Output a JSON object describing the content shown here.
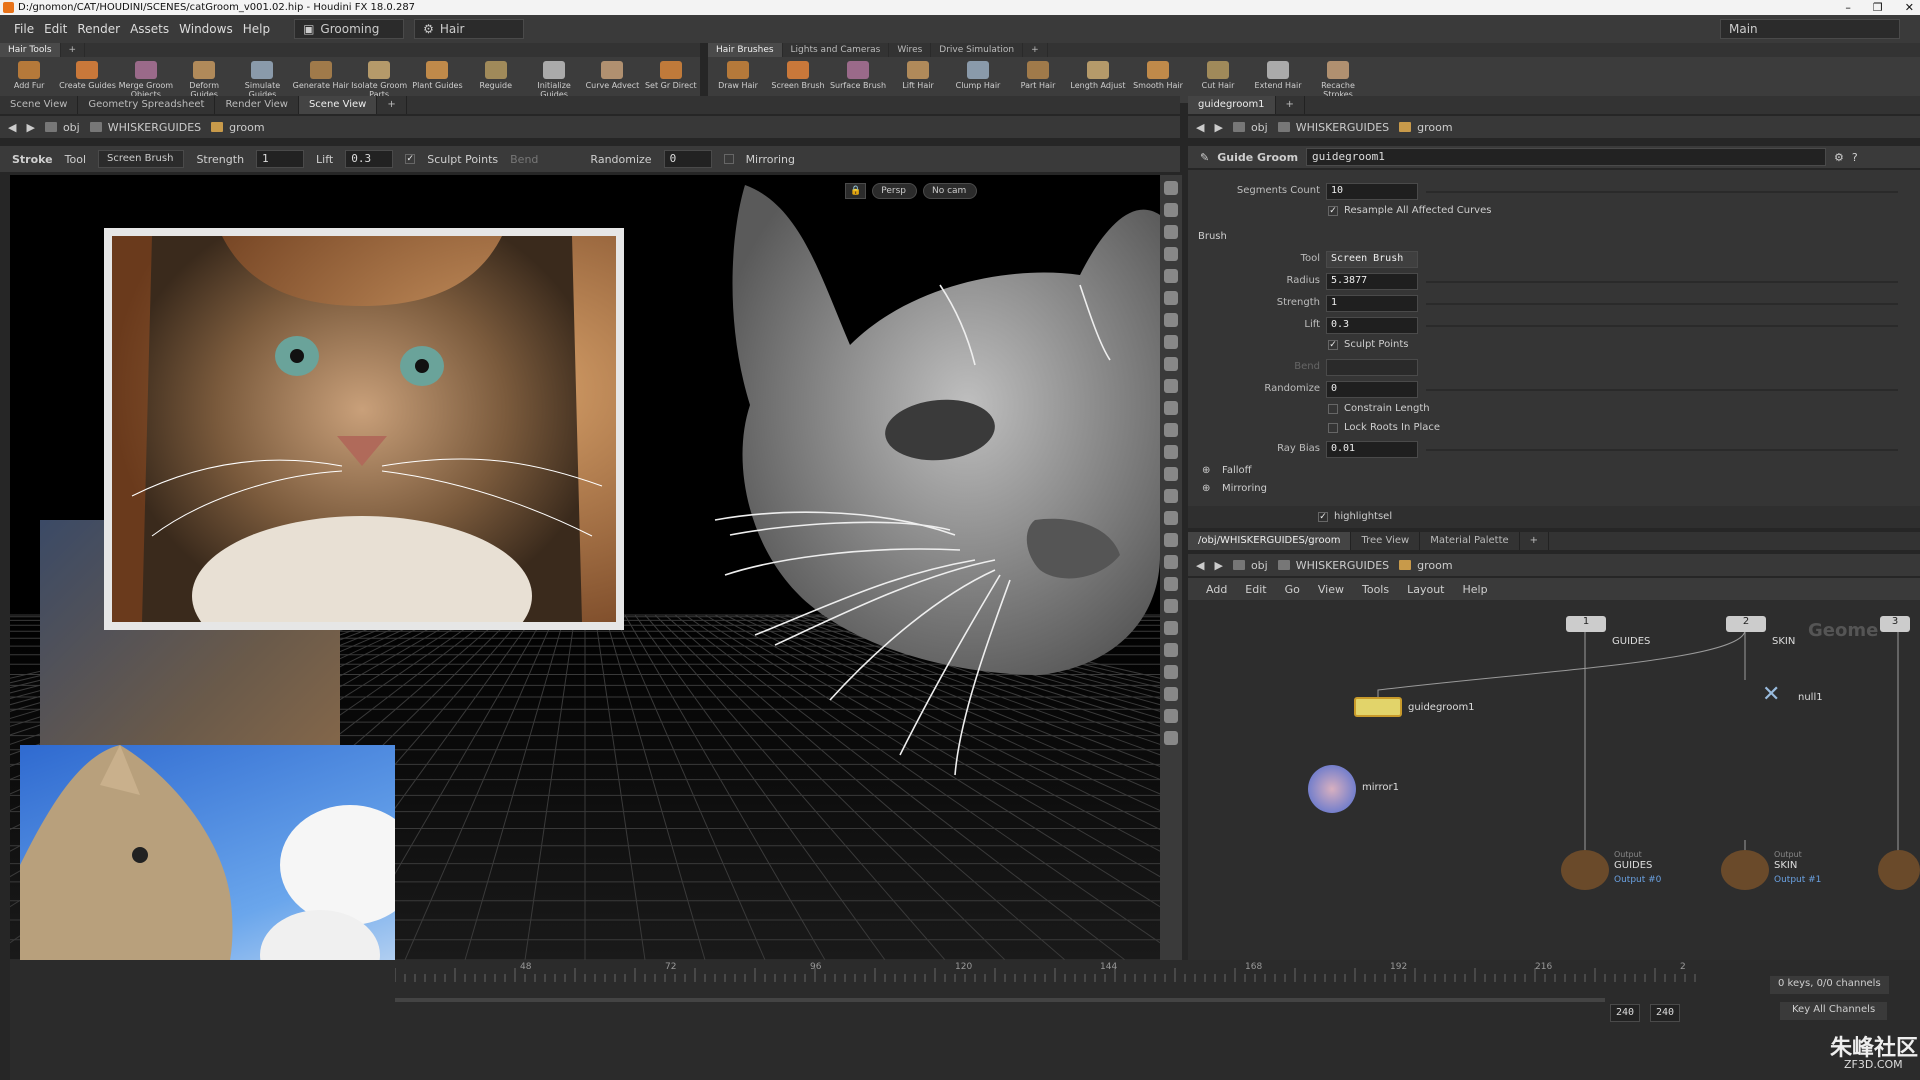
{
  "window": {
    "title": "D:/gnomon/CAT/HOUDINI/SCENES/catGroom_v001.02.hip - Houdini FX 18.0.287"
  },
  "menu": {
    "items": [
      "File",
      "Edit",
      "Render",
      "Assets",
      "Windows",
      "Help"
    ],
    "desktop": "Grooming",
    "context": "Hair",
    "layout": "Main"
  },
  "shelf_left": {
    "tabs": [
      "Hair Tools"
    ],
    "tools": [
      "Add Fur",
      "Create Guides",
      "Merge Groom Objects",
      "Deform Guides",
      "Simulate Guides",
      "Generate Hair",
      "Isolate Groom Parts",
      "Plant Guides",
      "Reguide",
      "Initialize Guides",
      "Curve Advect",
      "Set Gr Direct"
    ]
  },
  "shelf_right": {
    "tabs": [
      "Hair Brushes",
      "Lights and Cameras",
      "Wires",
      "Drive Simulation"
    ],
    "tools": [
      "Draw Hair",
      "Screen Brush",
      "Surface Brush",
      "Lift Hair",
      "Clump Hair",
      "Part Hair",
      "Length Adjust",
      "Smooth Hair",
      "Cut Hair",
      "Extend Hair",
      "Recache Strokes"
    ]
  },
  "left_tabs": [
    "Scene View",
    "Geometry Spreadsheet",
    "Render View",
    "Scene View"
  ],
  "left_path": {
    "obj": "obj",
    "guides": "WHISKERGUIDES",
    "groom": "groom"
  },
  "opbar": {
    "stroke": "Stroke",
    "tool": "Tool",
    "tool_value": "Screen Brush",
    "strength_label": "Strength",
    "strength": "1",
    "lift_label": "Lift",
    "lift": "0.3",
    "sculpt": "Sculpt Points",
    "bend": "Bend",
    "randomize_label": "Randomize",
    "randomize": "0",
    "mirroring": "Mirroring"
  },
  "viewport": {
    "persp": "Persp",
    "cam": "No cam"
  },
  "right_tabs": [
    "guidegroom1"
  ],
  "right_path": {
    "obj": "obj",
    "guides": "WHISKERGUIDES",
    "groom": "groom"
  },
  "parm_header": {
    "type": "Guide Groom",
    "name": "guidegroom1"
  },
  "parms": {
    "segments_count_label": "Segments Count",
    "segments_count": "10",
    "resample": "Resample All Affected Curves",
    "brush_section": "Brush",
    "tool_label": "Tool",
    "tool_value": "Screen Brush",
    "radius_label": "Radius",
    "radius": "5.3877",
    "strength_label": "Strength",
    "strength": "1",
    "lift_label": "Lift",
    "lift": "0.3",
    "sculpt": "Sculpt Points",
    "bend_label": "Bend",
    "randomize_label": "Randomize",
    "randomize": "0",
    "constrain": "Constrain Length",
    "lock": "Lock Roots In Place",
    "raybias_label": "Ray Bias",
    "raybias": "0.01",
    "falloff": "Falloff",
    "mirroring": "Mirroring",
    "highlight": "highlightsel"
  },
  "net_tabs": [
    "/obj/WHISKERGUIDES/groom",
    "Tree View",
    "Material Palette"
  ],
  "net_path": {
    "obj": "obj",
    "guides": "WHISKERGUIDES",
    "groom": "groom"
  },
  "net_menu": [
    "Add",
    "Edit",
    "Go",
    "View",
    "Tools",
    "Layout",
    "Help"
  ],
  "nodes": {
    "guides_num": "1",
    "guides": "GUIDES",
    "skin_num": "2",
    "skin": "SKIN",
    "three": "3",
    "geo_watermark": "Geome",
    "guidegroom": "guidegroom1",
    "null": "null1",
    "mirror": "mirror1",
    "out_guides_type": "Output",
    "out_guides": "GUIDES",
    "out_guides_sub": "Output #0",
    "out_skin_type": "Output",
    "out_skin": "SKIN",
    "out_skin_sub": "Output #1"
  },
  "timeline": {
    "ticks": [
      "48",
      "72",
      "96",
      "120",
      "144",
      "168",
      "192",
      "216",
      "2"
    ],
    "start": "240",
    "end": "240",
    "keys": "0 keys, 0/0 channels",
    "keyall": "Key All Channels"
  },
  "watermark": "朱峰社区",
  "watermark_sub": "ZF3D.COM"
}
